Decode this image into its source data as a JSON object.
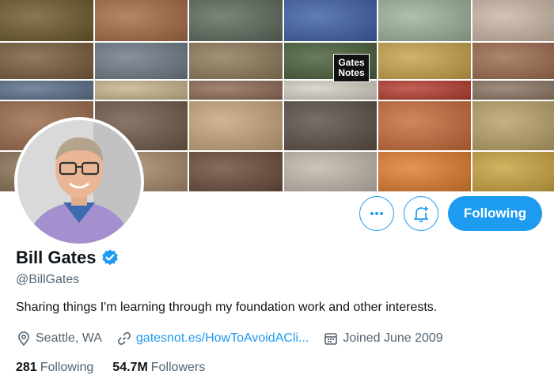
{
  "banner": {
    "gates_notes_line1": "Gates",
    "gates_notes_line2": "Notes",
    "tile_colors": [
      [
        "#6d5a2c",
        "#a66b45",
        "#5f6a5d",
        "#3f5fa8",
        "#9db39a",
        "#c9b6a5"
      ],
      [
        "#7a5c3d",
        "#6f7a86",
        "#8d7a5a",
        "#4a5e3a",
        "#c8a24b",
        "#9c6a4d"
      ],
      [
        "#5b6f8a",
        "#c7b48d",
        "#8f6a55",
        "#d6d0c5",
        "#b53d2f",
        "#8a7562"
      ],
      [
        "#9a6a4a",
        "#6f5a48",
        "#c5a57a",
        "#5a4f47",
        "#c76b3a",
        "#b8a066"
      ]
    ]
  },
  "profile": {
    "display_name": "Bill Gates",
    "handle": "@BillGates",
    "bio": "Sharing things I'm learning through my foundation work and other interests.",
    "location": "Seattle, WA",
    "link": "gatesnot.es/HowToAvoidACli...",
    "joined": "Joined June 2009",
    "following_count": "281",
    "following_label": "Following",
    "followers_count": "54.7M",
    "followers_label": "Followers"
  },
  "actions": {
    "following_button_label": "Following",
    "more_icon": "ellipsis-icon",
    "notify_icon": "bell-plus-icon"
  },
  "colors": {
    "accent": "#1d9bf0",
    "text_primary": "#0f1419",
    "text_secondary": "#536471"
  }
}
